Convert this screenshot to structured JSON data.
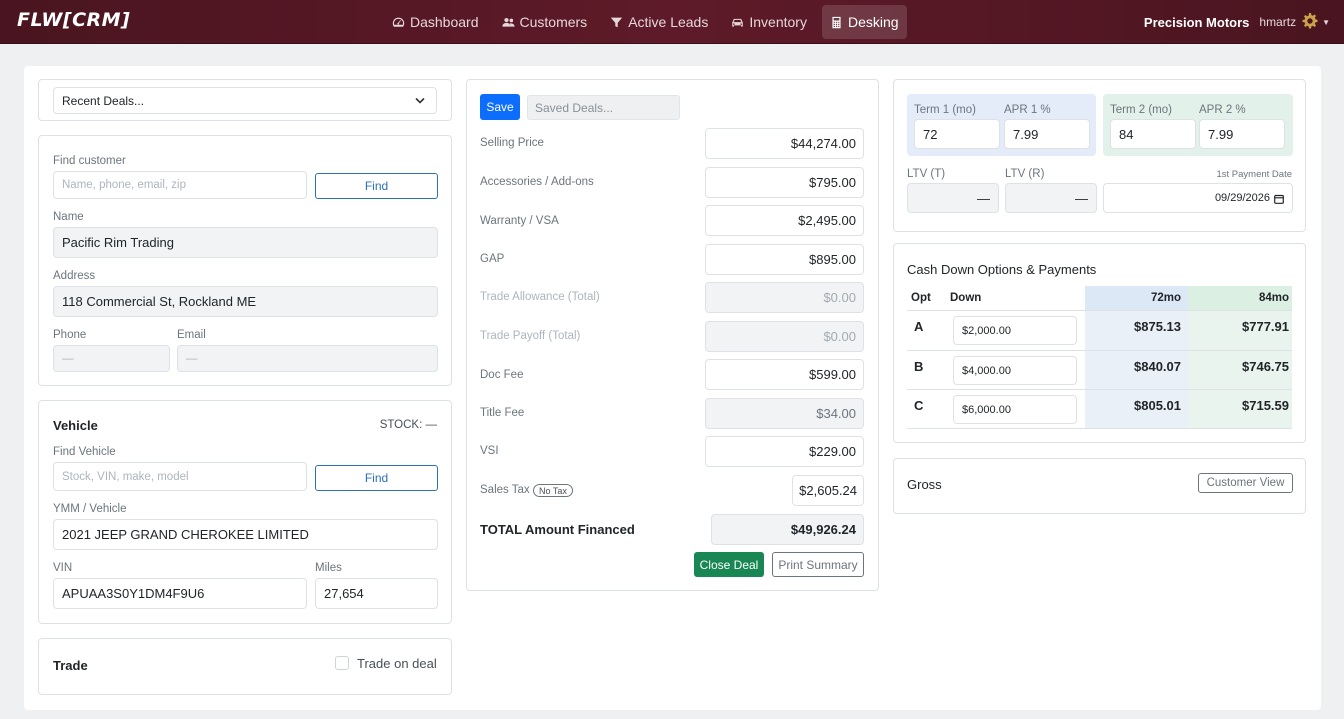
{
  "nav": {
    "brand": "FLW[CRM]",
    "items": [
      {
        "label": "Dashboard",
        "icon": "gauge-icon"
      },
      {
        "label": "Customers",
        "icon": "users-icon"
      },
      {
        "label": "Active Leads",
        "icon": "filter-icon"
      },
      {
        "label": "Inventory",
        "icon": "car-icon"
      },
      {
        "label": "Desking",
        "icon": "calculator-icon"
      }
    ],
    "active": "Desking",
    "dealer": "Precision Motors",
    "user": "hmartz"
  },
  "recent_deals": {
    "label": "Recent Deals..."
  },
  "customer": {
    "find_label": "Find customer",
    "find_placeholder": "Name, phone, email, zip",
    "find_button": "Find",
    "name_label": "Name",
    "name": "Pacific Rim Trading",
    "address_label": "Address",
    "address": "118 Commercial St, Rockland ME",
    "phone_label": "Phone",
    "phone": "—",
    "email_label": "Email",
    "email": "—"
  },
  "vehicle": {
    "title": "Vehicle",
    "stock": "STOCK: —",
    "find_label": "Find Vehicle",
    "find_placeholder": "Stock, VIN, make, model",
    "find_button": "Find",
    "ymm_label": "YMM / Vehicle",
    "ymm": "2021 JEEP GRAND CHEROKEE LIMITED",
    "vin_label": "VIN",
    "vin": "APUAA3S0Y1DM4F9U6",
    "miles_label": "Miles",
    "miles": "27,654"
  },
  "trade": {
    "title": "Trade",
    "checkbox_label": "Trade on deal"
  },
  "deal": {
    "save": "Save",
    "saved_deals": "Saved Deals...",
    "rows": [
      {
        "label": "Selling Price",
        "value": "$44,274.00"
      },
      {
        "label": "Accessories / Add-ons",
        "value": "$795.00"
      },
      {
        "label": "Warranty / VSA",
        "value": "$2,495.00"
      },
      {
        "label": "GAP",
        "value": "$895.00"
      },
      {
        "label": "Trade Allowance (Total)",
        "value": "$0.00"
      },
      {
        "label": "Trade Payoff (Total)",
        "value": "$0.00"
      },
      {
        "label": "Doc Fee",
        "value": "$599.00"
      },
      {
        "label": "Title Fee",
        "value": "$34.00"
      },
      {
        "label": "VSI",
        "value": "$229.00"
      }
    ],
    "sales_tax_label": "Sales Tax",
    "no_tax_badge": "No Tax",
    "sales_tax": "$2,605.24",
    "total_label": "TOTAL Amount Financed",
    "total": "$49,926.24",
    "close_deal": "Close Deal",
    "print_summary": "Print Summary"
  },
  "terms": {
    "term1_label": "Term 1 (mo)",
    "term1": "72",
    "apr1_label": "APR 1 %",
    "apr1": "7.99",
    "term2_label": "Term 2 (mo)",
    "term2": "84",
    "apr2_label": "APR 2 %",
    "apr2": "7.99",
    "ltv_t_label": "LTV (T)",
    "ltv_t": "—",
    "ltv_r_label": "LTV (R)",
    "ltv_r": "—",
    "first_payment_label": "1st Payment Date",
    "first_payment": "09/29/2026"
  },
  "payments": {
    "title": "Cash Down Options & Payments",
    "headers": {
      "opt": "Opt",
      "down": "Down",
      "t1": "72mo",
      "t2": "84mo"
    },
    "rows": [
      {
        "opt": "A",
        "down": "$2,000.00",
        "t1": "$875.13",
        "t2": "$777.91"
      },
      {
        "opt": "B",
        "down": "$4,000.00",
        "t1": "$840.07",
        "t2": "$746.75"
      },
      {
        "opt": "C",
        "down": "$6,000.00",
        "t1": "$805.01",
        "t2": "$715.59"
      }
    ]
  },
  "gross": {
    "title": "Gross",
    "customer_view": "Customer View"
  },
  "colors": {
    "nav_bg": "#5e1a28",
    "primary": "#0d6efd",
    "success": "#198754",
    "term1_bg": "#e3ecf8",
    "term2_bg": "#e2f1e9"
  }
}
